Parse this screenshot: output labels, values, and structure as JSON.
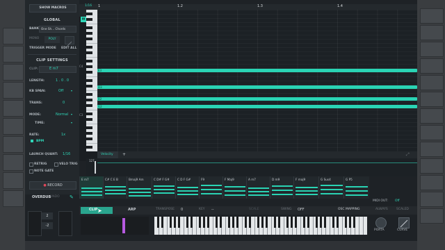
{
  "macros": {
    "show_label": "SHOW MACROS"
  },
  "global": {
    "header": "GLOBAL",
    "bank_label": "BANK:",
    "bank_value": "One Sh... Chords",
    "mono_label": "MONO",
    "poly_label": "POLY",
    "trigger_label": "TRIGGER MODE",
    "edit_all_label": "EDIT ALL"
  },
  "clip_settings": {
    "header": "CLIP SETTINGS",
    "clip_label": "CLIP:",
    "clip_value": "E m7",
    "length_label": "LENGTH:",
    "length_value": "1 . 0 . 0",
    "kb_span_label": "KB SPAN:",
    "kb_span_value": "Off",
    "trans_label": "TRANS:",
    "trans_value": "0",
    "mode_label": "MODE:",
    "mode_value": "Normal",
    "time_label": "TIME:",
    "rate_label": "RATE:",
    "rate_value": "1x",
    "bpm_label": "BPM",
    "launch_label": "LAUNCH QUANT:",
    "launch_value": "1/16",
    "retrig_label": "RETRIG",
    "velo_trig_label": "VELO TRIG",
    "note_gate_label": "NOTE GATE"
  },
  "piano_roll": {
    "ruler_marks": [
      "1/16",
      "1",
      "1.2",
      "1.3",
      "1.4"
    ],
    "octave_labels": [
      "C4",
      "C3"
    ],
    "notes": [
      "E3",
      "D3",
      "B2",
      "G2"
    ],
    "velocity_tab": "Velocity",
    "add_lane": "+",
    "velocity_value": "127"
  },
  "chords": [
    {
      "label": "E m7"
    },
    {
      "label": "C# C E B"
    },
    {
      "label": "Bmaj9 Am"
    },
    {
      "label": "C D# F G#"
    },
    {
      "label": "C D F G#"
    },
    {
      "label": "F9"
    },
    {
      "label": "F Maj9"
    },
    {
      "label": "A m7"
    },
    {
      "label": "D m9"
    },
    {
      "label": "F maj9"
    },
    {
      "label": "G Sus4"
    },
    {
      "label": "G P5"
    }
  ],
  "record": {
    "record_label": "RECORD",
    "overdub_label": "OVERDUB",
    "undo_label": "UNDO"
  },
  "midi_out": {
    "label": "MIDI OUT:",
    "value": "Off"
  },
  "bottom_bar": {
    "clip_tab": "CLIP",
    "arp_tab": "ARP",
    "transpose_label": "TRANSPOSE",
    "transpose_value": "0",
    "key_label": "KEY",
    "key_value": "--",
    "scale_label": "SCALE",
    "swing_label": "SWING",
    "swing_value": "OFF",
    "osc_mapping_label": "OSC MAPPING",
    "always_label": "ALWAYS",
    "scaled_label": "SCALED",
    "porta_label": "PORTA",
    "curve_label": "CURVE"
  },
  "steppers": {
    "octave_top": "2",
    "octave_bottom": "-2"
  }
}
